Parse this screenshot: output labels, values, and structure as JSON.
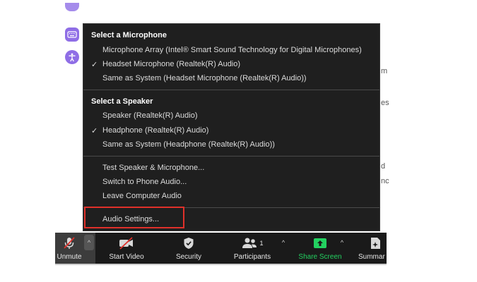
{
  "background_text": {
    "t1": "m",
    "t2": "es",
    "t3": "d",
    "t4": "nc"
  },
  "microphone_section": {
    "header": "Select a Microphone",
    "items": [
      {
        "label": "Microphone Array (Intel® Smart Sound Technology for Digital Microphones)",
        "checked": false
      },
      {
        "label": "Headset Microphone (Realtek(R) Audio)",
        "checked": true
      },
      {
        "label": "Same as System (Headset Microphone (Realtek(R) Audio))",
        "checked": false
      }
    ]
  },
  "speaker_section": {
    "header": "Select a Speaker",
    "items": [
      {
        "label": "Speaker (Realtek(R) Audio)",
        "checked": false
      },
      {
        "label": "Headphone (Realtek(R) Audio)",
        "checked": true
      },
      {
        "label": "Same as System (Headphone (Realtek(R) Audio))",
        "checked": false
      }
    ]
  },
  "actions": {
    "test": "Test Speaker & Microphone...",
    "phone": "Switch to Phone Audio...",
    "leave": "Leave Computer Audio",
    "settings": "Audio Settings..."
  },
  "check_glyph": "✓",
  "caret_glyph": "^",
  "toolbar": {
    "unmute": "Unmute",
    "start_video": "Start Video",
    "security": "Security",
    "participants": "Participants",
    "participants_count": "1",
    "share_screen": "Share Screen",
    "summary": "Summar"
  },
  "colors": {
    "menu_bg": "#1f1f1f",
    "toolbar_bg": "#1a1a1a",
    "highlight": "#e0302a",
    "share_green": "#23d160",
    "rail_purple": "#8f6ee6"
  },
  "icons": [
    "keyboard-icon",
    "accessibility-icon",
    "muted-mic-icon",
    "video-off-icon",
    "shield-icon",
    "participants-icon",
    "share-screen-icon",
    "summary-icon"
  ]
}
